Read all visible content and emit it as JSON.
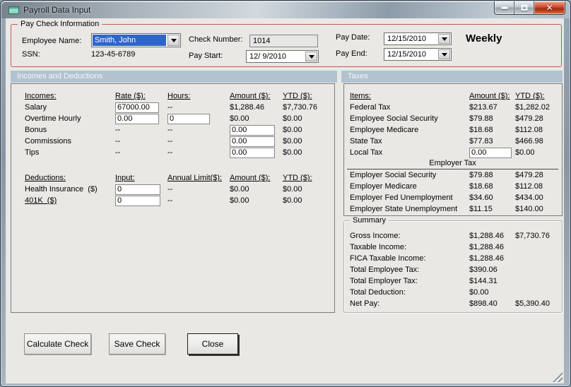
{
  "window": {
    "title": "Payroll Data Input"
  },
  "paycheck": {
    "group_title": "Pay Check Information",
    "employee_name_label": "Employee Name:",
    "employee_name": "Smith, John",
    "ssn_label": "SSN:",
    "ssn": "123-45-6789",
    "check_number_label": "Check Number:",
    "check_number": "1014",
    "pay_start_label": "Pay Start:",
    "pay_start": "12/ 9/2010",
    "pay_date_label": "Pay Date:",
    "pay_date": "12/15/2010",
    "pay_end_label": "Pay End:",
    "pay_end": "12/15/2010",
    "frequency": "Weekly"
  },
  "incomes": {
    "band_label": "Incomes and Deductions",
    "headers": {
      "col1": "Incomes:",
      "col2": "Rate ($):",
      "col3": "Hours:",
      "col4": "Amount ($):",
      "col5": "YTD ($):"
    },
    "rows": [
      {
        "name": "Salary",
        "rate": "67000.00",
        "hours": "--",
        "amount": "$1,288.46",
        "ytd": "$7,730.76"
      },
      {
        "name": "Overtime Hourly",
        "rate": "0.00",
        "hours": "0",
        "amount": "$0.00",
        "ytd": "$0.00"
      },
      {
        "name": "Bonus",
        "rate": "--",
        "hours": "--",
        "amount": "0.00",
        "ytd": "$0.00"
      },
      {
        "name": "Commissions",
        "rate": "--",
        "hours": "--",
        "amount": "0.00",
        "ytd": "$0.00"
      },
      {
        "name": "Tips",
        "rate": "--",
        "hours": "--",
        "amount": "0.00",
        "ytd": "$0.00"
      }
    ],
    "deduction_headers": {
      "col1": "Deductions:",
      "col2": "Input:",
      "col3": "Annual Limit($):",
      "col4": "Amount ($):",
      "col5": "YTD ($):"
    },
    "deduction_rows": [
      {
        "name": "Health Insurance  ($)",
        "input": "0",
        "limit": "--",
        "amount": "$0.00",
        "ytd": "$0.00"
      },
      {
        "name": "401K  ($)",
        "input": "0",
        "limit": "--",
        "amount": "$0.00",
        "ytd": "$0.00"
      }
    ]
  },
  "taxes": {
    "band_label": "Taxes",
    "headers": {
      "col1": "Items:",
      "col2": "Amount ($):",
      "col3": "YTD ($):"
    },
    "rows": [
      {
        "name": "Federal Tax",
        "amount": "$213.67",
        "ytd": "$1,282.02"
      },
      {
        "name": "Employee Social Security",
        "amount": "$79.88",
        "ytd": "$479.28"
      },
      {
        "name": "Employee Medicare",
        "amount": "$18.68",
        "ytd": "$112.08"
      },
      {
        "name": "State Tax",
        "amount": "$77.83",
        "ytd": "$466.98"
      },
      {
        "name": "Local Tax",
        "amount": "0.00",
        "ytd": "$0.00"
      }
    ],
    "employer_header": "Employer Tax",
    "employer_rows": [
      {
        "name": "Employer Social Security",
        "amount": "$79.88",
        "ytd": "$479.28"
      },
      {
        "name": "Employer Medicare",
        "amount": "$18.68",
        "ytd": "$112.08"
      },
      {
        "name": "Employer Fed Unemployment",
        "amount": "$34.60",
        "ytd": "$434.00"
      },
      {
        "name": "Employer State Unemployment",
        "amount": "$11.15",
        "ytd": "$140.00"
      }
    ]
  },
  "summary": {
    "group_title": "Summary",
    "rows": [
      {
        "label": "Gross Income:",
        "amount": "$1,288.46",
        "ytd": "$7,730.76"
      },
      {
        "label": "Taxable Income:",
        "amount": "$1,288.46",
        "ytd": ""
      },
      {
        "label": "FICA Taxable Income:",
        "amount": "$1,288.46",
        "ytd": ""
      },
      {
        "label": "Total Employee Tax:",
        "amount": "$390.06",
        "ytd": ""
      },
      {
        "label": "Total Employer Tax:",
        "amount": "$144.31",
        "ytd": ""
      },
      {
        "label": "Total Deduction:",
        "amount": "$0.00",
        "ytd": ""
      },
      {
        "label": "Net Pay:",
        "amount": "$898.40",
        "ytd": "$5,390.40"
      }
    ]
  },
  "buttons": {
    "calculate": "Calculate Check",
    "save": "Save Check",
    "close": "Close"
  },
  "colors": {
    "group_border_red": "#C05B57",
    "band_background": "#B2C3CF",
    "selection_blue": "#2E66C8",
    "close_button_red": "#B02A18",
    "client_background": "#E9E8E5"
  }
}
